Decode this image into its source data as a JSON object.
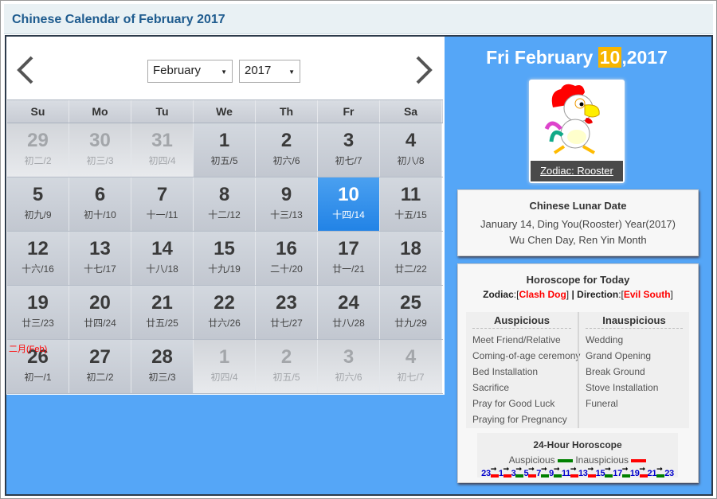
{
  "title": "Chinese Calendar of February 2017",
  "nav": {
    "month": "February",
    "year": "2017"
  },
  "weekdays": [
    "Su",
    "Mo",
    "Tu",
    "We",
    "Th",
    "Fr",
    "Sa"
  ],
  "weeks": [
    [
      {
        "d": "29",
        "l": "初二/2",
        "o": true
      },
      {
        "d": "30",
        "l": "初三/3",
        "o": true
      },
      {
        "d": "31",
        "l": "初四/4",
        "o": true
      },
      {
        "d": "1",
        "l": "初五/5"
      },
      {
        "d": "2",
        "l": "初六/6"
      },
      {
        "d": "3",
        "l": "初七/7"
      },
      {
        "d": "4",
        "l": "初八/8"
      }
    ],
    [
      {
        "d": "5",
        "l": "初九/9"
      },
      {
        "d": "6",
        "l": "初十/10"
      },
      {
        "d": "7",
        "l": "十一/11"
      },
      {
        "d": "8",
        "l": "十二/12"
      },
      {
        "d": "9",
        "l": "十三/13"
      },
      {
        "d": "10",
        "l": "十四/14",
        "t": true
      },
      {
        "d": "11",
        "l": "十五/15"
      }
    ],
    [
      {
        "d": "12",
        "l": "十六/16"
      },
      {
        "d": "13",
        "l": "十七/17"
      },
      {
        "d": "14",
        "l": "十八/18"
      },
      {
        "d": "15",
        "l": "十九/19"
      },
      {
        "d": "16",
        "l": "二十/20"
      },
      {
        "d": "17",
        "l": "廿一/21"
      },
      {
        "d": "18",
        "l": "廿二/22"
      }
    ],
    [
      {
        "d": "19",
        "l": "廿三/23"
      },
      {
        "d": "20",
        "l": "廿四/24"
      },
      {
        "d": "21",
        "l": "廿五/25"
      },
      {
        "d": "22",
        "l": "廿六/26"
      },
      {
        "d": "23",
        "l": "廿七/27"
      },
      {
        "d": "24",
        "l": "廿八/28"
      },
      {
        "d": "25",
        "l": "廿九/29"
      }
    ],
    [
      {
        "d": "26",
        "l": "初一/1",
        "m": "二月(Feb)"
      },
      {
        "d": "27",
        "l": "初二/2"
      },
      {
        "d": "28",
        "l": "初三/3"
      },
      {
        "d": "1",
        "l": "初四/4",
        "o": true
      },
      {
        "d": "2",
        "l": "初五/5",
        "o": true
      },
      {
        "d": "3",
        "l": "初六/6",
        "o": true
      },
      {
        "d": "4",
        "l": "初七/7",
        "o": true
      }
    ]
  ],
  "selected": {
    "pre": "Fri February ",
    "day": "10",
    "post": ",2017"
  },
  "zodiac": {
    "caption": "Zodiac: Rooster"
  },
  "lunar": {
    "title": "Chinese Lunar Date",
    "line1": "January 14, Ding You(Rooster) Year(2017)",
    "line2": "Wu Chen Day, Ren Yin Month"
  },
  "horoscope": {
    "title": "Horoscope for Today",
    "zodiac_label": "Zodiac",
    "clash": "Clash Dog",
    "direction_label": "Direction",
    "evil": "Evil South",
    "auspicious_title": "Auspicious",
    "auspicious": [
      "Meet Friend/Relative",
      "Coming-of-age ceremony",
      "Bed Installation",
      "Sacrifice",
      "Pray for Good Luck",
      "Praying for Pregnancy"
    ],
    "inauspicious_title": "Inauspicious",
    "inauspicious": [
      "Wedding",
      "Grand Opening",
      "Break Ground",
      "Stove Installation",
      "Funeral"
    ]
  },
  "hours": {
    "title": "24-Hour Horoscope",
    "legend_good": "Auspicious",
    "legend_bad": "Inauspicious",
    "marks": [
      "23",
      "1",
      "3",
      "5",
      "7",
      "9",
      "11",
      "13",
      "15",
      "17",
      "19",
      "21",
      "23"
    ],
    "segments": [
      "bad",
      "bad",
      "good",
      "bad",
      "good",
      "good",
      "bad",
      "bad",
      "good",
      "good",
      "bad",
      "good"
    ]
  },
  "colors": {
    "good": "#008000",
    "bad": "#ff0000",
    "accent": "#55a6f7",
    "highlight": "#f7b500"
  }
}
